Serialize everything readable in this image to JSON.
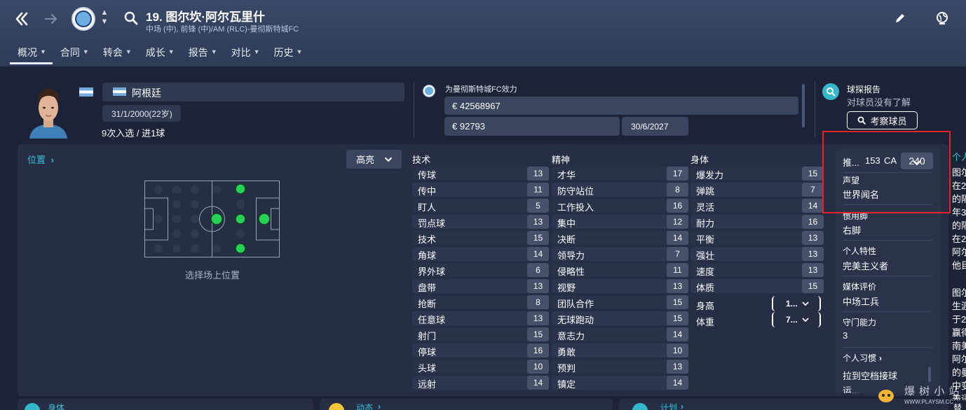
{
  "header": {
    "player_title": "19. 图尔坎·阿尔瓦里什",
    "player_sub": "中场 (中), 前锋 (中)/AM (RLC)-曼彻斯特城FC",
    "tabs": [
      "概况",
      "合同",
      "转会",
      "成长",
      "报告",
      "对比",
      "历史"
    ]
  },
  "profile": {
    "nationality": "阿根廷",
    "dob": "31/1/2000(22岁)",
    "caps": "9次入选 / 进1球"
  },
  "contract": {
    "plays_for": "为曼彻斯特城FC效力",
    "value": "€ 42568967",
    "wage": "€ 92793",
    "expires": "30/6/2027"
  },
  "scout": {
    "title": "球探报告",
    "subtitle": "对球员没有了解",
    "button": "考察球员"
  },
  "position": {
    "title": "位置",
    "highlight_label": "高亮",
    "hint": "选择场上位置"
  },
  "attributes": {
    "technical": {
      "title": "技术",
      "items": [
        {
          "name": "传球",
          "value": "13"
        },
        {
          "name": "传中",
          "value": "11"
        },
        {
          "name": "盯人",
          "value": "5"
        },
        {
          "name": "罚点球",
          "value": "13"
        },
        {
          "name": "技术",
          "value": "15"
        },
        {
          "name": "角球",
          "value": "14"
        },
        {
          "name": "界外球",
          "value": "6"
        },
        {
          "name": "盘带",
          "value": "13"
        },
        {
          "name": "抢断",
          "value": "8"
        },
        {
          "name": "任意球",
          "value": "13"
        },
        {
          "name": "射门",
          "value": "15"
        },
        {
          "name": "停球",
          "value": "16"
        },
        {
          "name": "头球",
          "value": "10"
        },
        {
          "name": "远射",
          "value": "14"
        }
      ]
    },
    "mental": {
      "title": "精神",
      "items": [
        {
          "name": "才华",
          "value": "17"
        },
        {
          "name": "防守站位",
          "value": "8"
        },
        {
          "name": "工作投入",
          "value": "16"
        },
        {
          "name": "集中",
          "value": "12"
        },
        {
          "name": "决断",
          "value": "14"
        },
        {
          "name": "领导力",
          "value": "7"
        },
        {
          "name": "侵略性",
          "value": "11"
        },
        {
          "name": "视野",
          "value": "13"
        },
        {
          "name": "团队合作",
          "value": "15"
        },
        {
          "name": "无球跑动",
          "value": "15"
        },
        {
          "name": "意志力",
          "value": "14"
        },
        {
          "name": "勇敢",
          "value": "10"
        },
        {
          "name": "预判",
          "value": "13"
        },
        {
          "name": "镇定",
          "value": "14"
        }
      ]
    },
    "physical": {
      "title": "身体",
      "items": [
        {
          "name": "爆发力",
          "value": "15"
        },
        {
          "name": "弹跳",
          "value": "7"
        },
        {
          "name": "灵活",
          "value": "14"
        },
        {
          "name": "耐力",
          "value": "16"
        },
        {
          "name": "平衡",
          "value": "13"
        },
        {
          "name": "强壮",
          "value": "13"
        },
        {
          "name": "速度",
          "value": "13"
        },
        {
          "name": "体质",
          "value": "15"
        }
      ],
      "height_label": "身高",
      "height_value": "1...",
      "weight_label": "体重",
      "weight_value": "7..."
    }
  },
  "info": {
    "pa_label": "推...",
    "pa_value": "153",
    "ca_label": "CA",
    "ca_value": "240",
    "reputation_label": "声望",
    "reputation_value": "世界闻名",
    "foot_label": "惯用脚",
    "foot_value": "右脚",
    "personality_label": "个人特性",
    "personality_value": "完美主义者",
    "media_label": "媒体评价",
    "media_value": "中场工兵",
    "gk_label": "守门能力",
    "gk_value": "3",
    "habits_label": "个人习惯",
    "habits_value": "拉到空档接球",
    "habits_more": "运..."
  },
  "bio": {
    "title": "个人",
    "lines": [
      "图尔",
      "在2",
      "的隔",
      "年3",
      "的隔",
      "在2",
      "阿尔",
      "他目",
      "图尔",
      "生涯",
      "于2",
      "赢得",
      "南美",
      "阿尔",
      "的曼",
      "中变",
      "表语"
    ]
  },
  "bottom": {
    "physical": "身体",
    "dynamics": "动态",
    "plan": "计划",
    "extra": "替"
  },
  "watermark": {
    "text": "爆 树 小 站",
    "url": "WWW.PLAYSM.CC"
  }
}
